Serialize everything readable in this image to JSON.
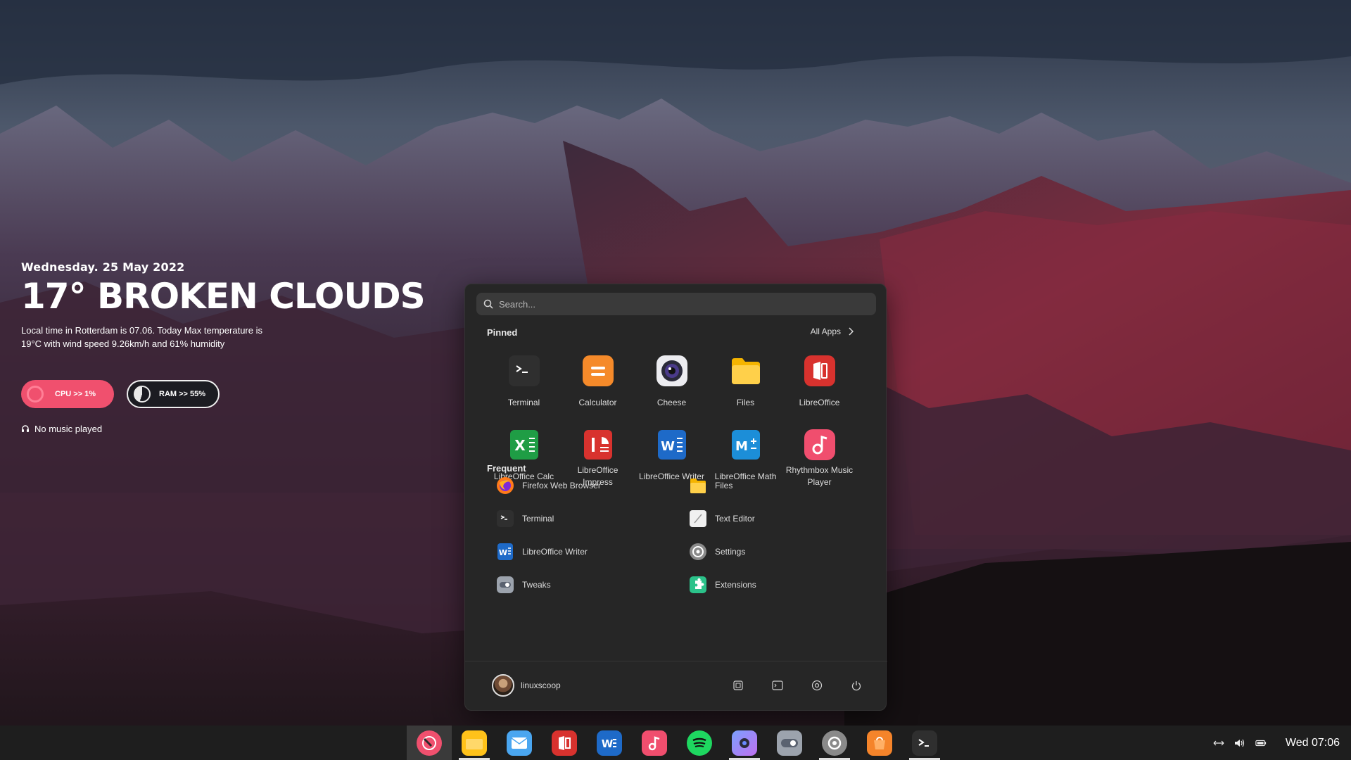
{
  "widget": {
    "date": "Wednesday. 25 May 2022",
    "weather": "17° BROKEN CLOUDS",
    "description": "Local time in Rotterdam  is 07.06. Today Max temperature is 19°C with wind speed 9.26km/h and 61% humidity",
    "cpu_label": "CPU >> 1%",
    "cpu_percent": 1,
    "ram_label": "RAM >> 55%",
    "ram_percent": 55,
    "music": "No music played"
  },
  "menu": {
    "search_placeholder": "Search...",
    "pinned_title": "Pinned",
    "all_apps_label": "All Apps",
    "pinned": [
      {
        "label": "Terminal",
        "icon": "terminal-icon"
      },
      {
        "label": "Calculator",
        "icon": "calculator-icon"
      },
      {
        "label": "Cheese",
        "icon": "cheese-icon"
      },
      {
        "label": "Files",
        "icon": "folder-icon"
      },
      {
        "label": "LibreOffice",
        "icon": "libreoffice-icon"
      },
      {
        "label": "LibreOffice Calc",
        "icon": "libreoffice-calc-icon"
      },
      {
        "label": "LibreOffice Impress",
        "icon": "libreoffice-impress-icon"
      },
      {
        "label": "LibreOffice Writer",
        "icon": "libreoffice-writer-icon"
      },
      {
        "label": "LibreOffice Math",
        "icon": "libreoffice-math-icon"
      },
      {
        "label": "Rhythmbox Music Player",
        "icon": "rhythmbox-icon"
      }
    ],
    "frequent_title": "Frequent",
    "frequent": [
      {
        "label": "Firefox Web Browser",
        "icon": "firefox-icon"
      },
      {
        "label": "Files",
        "icon": "folder-icon"
      },
      {
        "label": "Terminal",
        "icon": "terminal-icon"
      },
      {
        "label": "Text Editor",
        "icon": "text-editor-icon"
      },
      {
        "label": "LibreOffice Writer",
        "icon": "libreoffice-writer-icon"
      },
      {
        "label": "Settings",
        "icon": "settings-icon"
      },
      {
        "label": "Tweaks",
        "icon": "tweaks-icon"
      },
      {
        "label": "Extensions",
        "icon": "extensions-icon"
      }
    ],
    "user_name": "linuxscoop",
    "footer_buttons": [
      "screenshot-icon",
      "terminal-icon",
      "settings-icon",
      "power-icon"
    ]
  },
  "taskbar": {
    "apps": [
      "menu-icon",
      "files-icon",
      "mail-icon",
      "libreoffice-icon",
      "writer-icon",
      "music-icon",
      "spotify-icon",
      "screenshot-tool-icon",
      "tweaks-icon",
      "settings-icon",
      "software-icon",
      "terminal-icon"
    ],
    "clock": "Wed 07:06",
    "accent": "#f0506e"
  }
}
